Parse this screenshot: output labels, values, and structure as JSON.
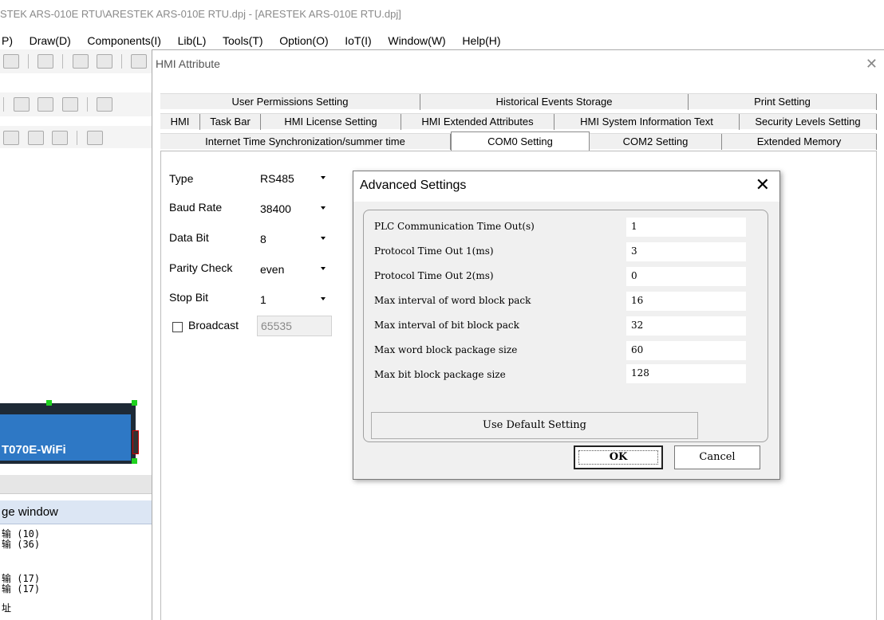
{
  "window": {
    "title": "STEK ARS-010E RTU\\ARESTEK ARS-010E RTU.dpj - [ARESTEK ARS-010E RTU.dpj]"
  },
  "menubar": {
    "items": [
      "P)",
      "Draw(D)",
      "Components(I)",
      "Lib(L)",
      "Tools(T)",
      "Option(O)",
      "IoT(I)",
      "Window(W)",
      "Help(H)"
    ]
  },
  "left_panel": {
    "device_label": "T070E-WiFi",
    "page_window_title": "ge window",
    "items": [
      "输 (10)",
      "输 (36)",
      "输 (17)",
      "输 (17)",
      "址"
    ]
  },
  "hmi_dialog": {
    "title": "HMI Attribute",
    "close_glyph": "✕",
    "tabs_row1": [
      "User Permissions Setting",
      "Historical Events Storage",
      "Print Setting"
    ],
    "tabs_row2": [
      "HMI",
      "Task Bar",
      "HMI License Setting",
      "HMI Extended Attributes",
      "HMI System Information Text",
      "Security Levels Setting"
    ],
    "tabs_row3": [
      "Internet Time Synchronization/summer time",
      "COM0 Setting",
      "COM2 Setting",
      "Extended Memory"
    ],
    "active_tab": "COM0 Setting",
    "fields": [
      {
        "label": "Type",
        "value": "RS485"
      },
      {
        "label": "Baud Rate",
        "value": "38400"
      },
      {
        "label": "Data Bit",
        "value": "8"
      },
      {
        "label": "Parity Check",
        "value": "even"
      },
      {
        "label": "Stop Bit",
        "value": "1"
      }
    ],
    "broadcast": {
      "label": "Broadcast",
      "value": "65535",
      "checked": false
    }
  },
  "advanced_dialog": {
    "title": "Advanced Settings",
    "close_glyph": "✕",
    "rows": [
      {
        "label": "PLC Communication Time Out(s)",
        "value": "1"
      },
      {
        "label": "Protocol Time Out 1(ms)",
        "value": "3"
      },
      {
        "label": "Protocol Time Out 2(ms)",
        "value": "0"
      },
      {
        "label": "Max interval of word block pack",
        "value": "16"
      },
      {
        "label": "Max interval of bit block pack",
        "value": "32"
      },
      {
        "label": "Max word block package size",
        "value": "60"
      },
      {
        "label": "Max bit block package size",
        "value": "128"
      }
    ],
    "default_button": "Use Default Setting",
    "ok_button": "OK",
    "cancel_button": "Cancel"
  },
  "colors": {
    "device_screen": "#2e78c5",
    "device_body": "#1e2a36",
    "selection_handle": "#1fd21f",
    "page_window_header": "#dce6f4"
  }
}
